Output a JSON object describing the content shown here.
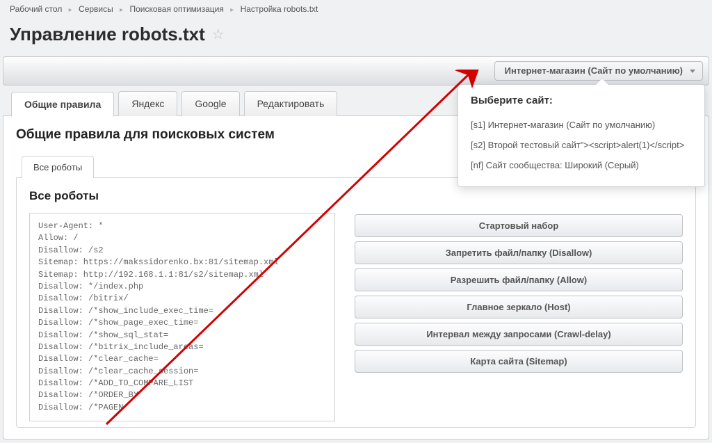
{
  "breadcrumb": {
    "items": [
      "Рабочий стол",
      "Сервисы",
      "Поисковая оптимизация",
      "Настройка robots.txt"
    ]
  },
  "page_title": "Управление robots.txt",
  "site_selector": {
    "selected": "Интернет-магазин (Сайт по умолчанию)"
  },
  "dropdown": {
    "title": "Выберите сайт:",
    "options": [
      "[s1] Интернет-магазин (Сайт по умолчанию)",
      "[s2] Второй тестовый сайт\"><script>alert(1)</script>",
      "[nf] Сайт сообщества: Широкий (Серый)"
    ]
  },
  "top_tabs": {
    "items": [
      "Общие правила",
      "Яндекс",
      "Google",
      "Редактировать"
    ]
  },
  "panel": {
    "heading": "Общие правила для поисковых систем"
  },
  "inner_tab": {
    "label": "Все роботы",
    "heading": "Все роботы"
  },
  "robots_code": "User-Agent: *\nAllow: /\nDisallow: /s2\nSitemap: https://makssidorenko.bx:81/sitemap.xml\nSitemap: http://192.168.1.1:81/s2/sitemap.xml\nDisallow: */index.php\nDisallow: /bitrix/\nDisallow: /*show_include_exec_time=\nDisallow: /*show_page_exec_time=\nDisallow: /*show_sql_stat=\nDisallow: /*bitrix_include_areas=\nDisallow: /*clear_cache=\nDisallow: /*clear_cache_session=\nDisallow: /*ADD_TO_COMPARE_LIST\nDisallow: /*ORDER_BY\nDisallow: /*PAGEN",
  "actions": {
    "buttons": [
      "Стартовый набор",
      "Запретить файл/папку (Disallow)",
      "Разрешить файл/папку (Allow)",
      "Главное зеркало (Host)",
      "Интервал между запросами (Crawl-delay)",
      "Карта сайта (Sitemap)"
    ]
  }
}
